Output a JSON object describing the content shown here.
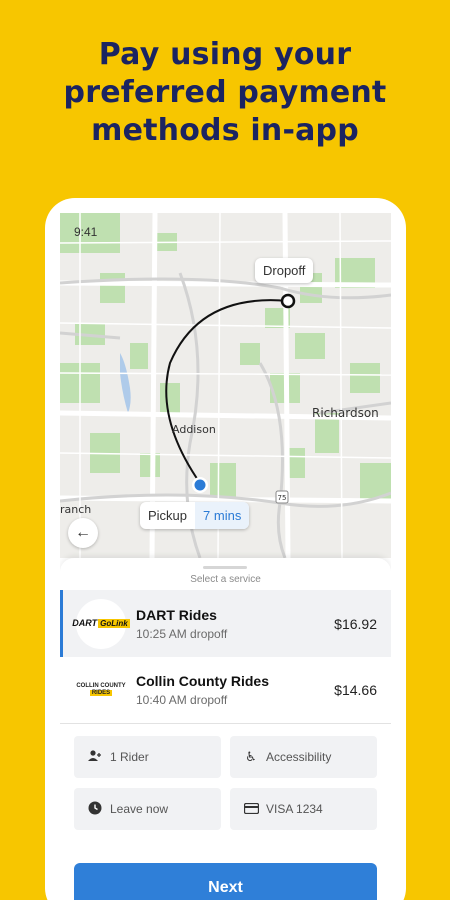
{
  "headline": {
    "line1": "Pay using your",
    "line2": "preferred payment",
    "line3": "methods in-app"
  },
  "status_bar": {
    "time": "9:41"
  },
  "map": {
    "dropoff_label": "Dropoff",
    "pickup_label": "Pickup",
    "pickup_eta": "7 mins",
    "places": [
      "Richardson",
      "Addison",
      "Farmers Branch"
    ],
    "place_labels_visible": [
      "Richardson",
      "Addison",
      "ranch"
    ],
    "highway_marker": "75",
    "back_icon": "arrow-left-icon",
    "colors": {
      "route": "#111111",
      "pickup_dot": "#2B7BD6",
      "park": "#BFE0B0",
      "road": "#FFFFFF"
    }
  },
  "sheet": {
    "title": "Select a service",
    "services": [
      {
        "name": "DART Rides",
        "detail": "10:25 AM dropoff",
        "price": "$16.92",
        "logo_text": "DART",
        "logo_badge": "GoLink",
        "selected": true
      },
      {
        "name": "Collin County Rides",
        "detail": "10:40 AM dropoff",
        "price": "$14.66",
        "logo_text": "COLLIN COUNTY",
        "logo_badge": "RIDES",
        "selected": false
      }
    ],
    "options": {
      "riders": {
        "label": "1 Rider",
        "icon": "person-add-icon"
      },
      "accessibility": {
        "label": "Accessibility",
        "icon": "wheelchair-icon"
      },
      "time": {
        "label": "Leave now",
        "icon": "clock-icon"
      },
      "payment": {
        "label": "VISA 1234",
        "icon": "credit-card-icon"
      }
    },
    "next_label": "Next"
  },
  "colors": {
    "background": "#F7C600",
    "headline": "#1B2461",
    "accent": "#2F7FD8",
    "selected_row": "#F1F2F4"
  }
}
